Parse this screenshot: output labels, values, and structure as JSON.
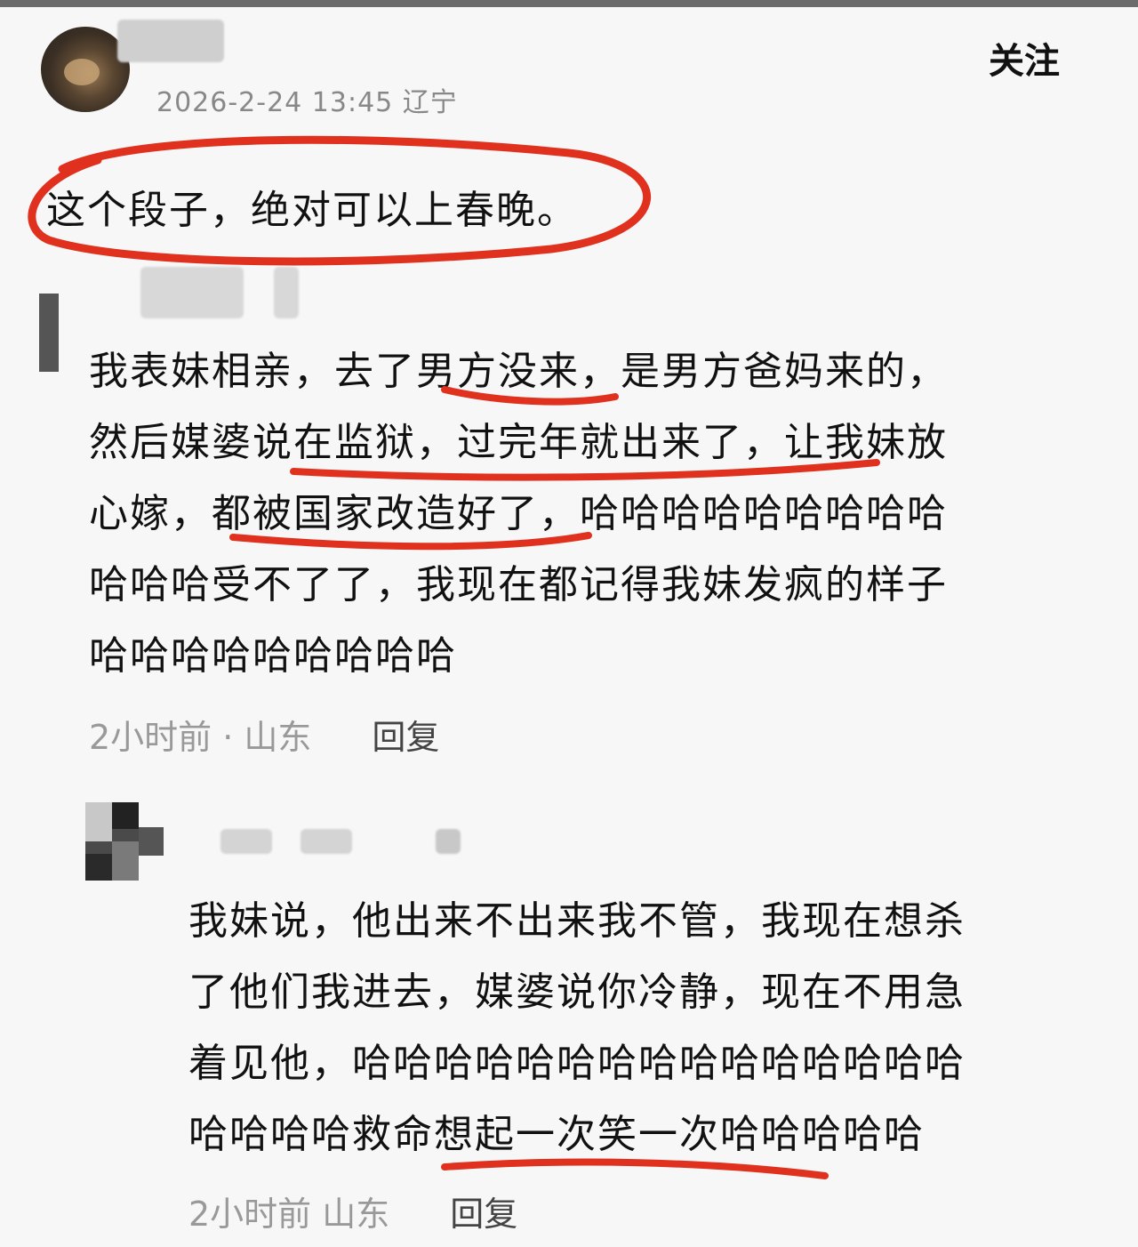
{
  "post": {
    "meta": "2026-2-24 13:45 辽宁",
    "follow_label": "关注",
    "text": "这个段子，绝对可以上春晚。"
  },
  "comments": [
    {
      "lines": [
        "我表妹相亲，去了男方没来，是男方爸妈来的，",
        "然后媒婆说在监狱，过完年就出来了，让我妹放",
        "心嫁，都被国家改造好了，哈哈哈哈哈哈哈哈哈",
        "哈哈哈受不了了，我现在都记得我妹发疯的样子",
        "哈哈哈哈哈哈哈哈哈"
      ],
      "time": "2小时前 · 山东",
      "reply_label": "回复"
    },
    {
      "lines": [
        "我妹说，他出来不出来我不管，我现在想杀",
        "了他们我进去，媒婆说你冷静，现在不用急",
        "着见他，哈哈哈哈哈哈哈哈哈哈哈哈哈哈哈",
        "哈哈哈哈救命想起一次笑一次哈哈哈哈哈"
      ],
      "time": "2小时前   山东",
      "reply_label": "回复"
    }
  ],
  "colors": {
    "annotation": "#e0301e",
    "meta_gray": "#999999"
  }
}
